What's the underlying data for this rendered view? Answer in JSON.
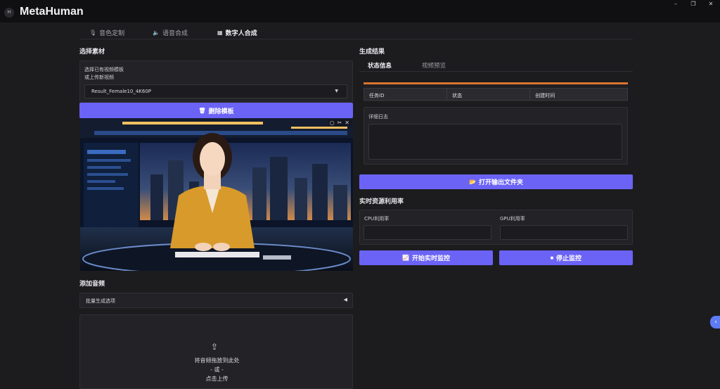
{
  "app": {
    "title": "MetaHuman",
    "logo_glyph": "H"
  },
  "window_controls": {
    "minimize": "–",
    "restore": "❐",
    "close": "✕"
  },
  "tabs": [
    {
      "label": "音色定制",
      "icon": "mic-icon"
    },
    {
      "label": "语音合成",
      "icon": "speaker-icon"
    },
    {
      "label": "数字人合成",
      "icon": "grid-icon",
      "active": true
    }
  ],
  "left": {
    "material_title": "选择素材",
    "template_label": "选择已有视频模板",
    "upload_label": "或上传新视频",
    "template_selected": "Result_Female10_4K60P",
    "delete_button": "删除模板",
    "audio_title": "添加音频",
    "batch_options": "批量生成选项",
    "upload_prompt": "将音频拖放到此处",
    "upload_or": "- 或 -",
    "upload_click": "点击上传"
  },
  "right": {
    "result_title": "生成结果",
    "sub_tabs": [
      {
        "label": "状态信息",
        "active": true
      },
      {
        "label": "视频预览"
      }
    ],
    "status_columns": [
      "任务ID",
      "状态",
      "创建时间"
    ],
    "log_label": "详细日志",
    "open_folder_button": "打开输出文件夹",
    "resource_title": "实时资源利用率",
    "cpu_label": "CPU利用率",
    "gpu_label": "GPU利用率",
    "start_monitor_button": "开始实时监控",
    "stop_monitor_button": "停止监控"
  },
  "colors": {
    "accent": "#6b63f5",
    "progress": "#d9742c",
    "bg": "#1c1c1f"
  }
}
